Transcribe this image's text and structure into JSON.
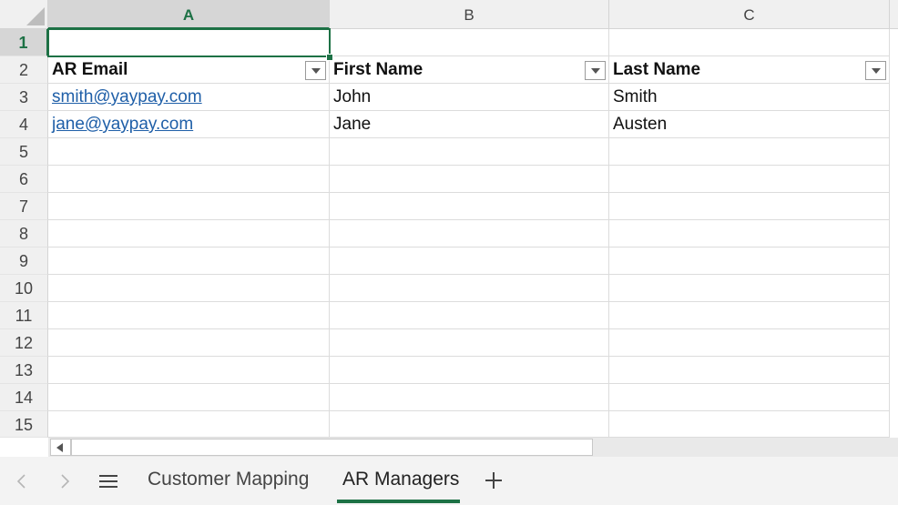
{
  "columns": [
    {
      "label": "A",
      "selected": true
    },
    {
      "label": "B",
      "selected": false
    },
    {
      "label": "C",
      "selected": false
    }
  ],
  "rows": [
    "1",
    "2",
    "3",
    "4",
    "5",
    "6",
    "7",
    "8",
    "9",
    "10",
    "11",
    "12",
    "13",
    "14",
    "15"
  ],
  "active_cell": "A1",
  "table": {
    "headers": [
      "AR Email",
      "First Name",
      "Last Name"
    ],
    "data": [
      [
        "smith@yaypay.com",
        "John",
        "Smith"
      ],
      [
        "jane@yaypay.com",
        "Jane",
        "Austen"
      ]
    ]
  },
  "sheet_tabs": [
    {
      "label": "Customer Mapping",
      "active": false
    },
    {
      "label": "AR Managers",
      "active": true
    }
  ],
  "icons": {
    "prev_sheet": "chevron-left-icon",
    "next_sheet": "chevron-right-icon",
    "all_sheets": "hamburger-menu-icon",
    "add_sheet": "plus-icon",
    "filter": "filter-dropdown-icon",
    "scroll_left": "arrow-left-icon"
  },
  "colors": {
    "accent": "#1d7145",
    "link": "#1f5fa8"
  }
}
